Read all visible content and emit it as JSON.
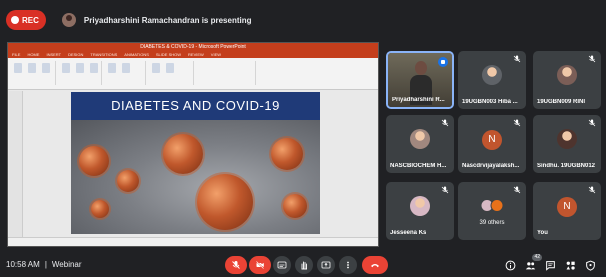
{
  "top": {
    "rec_label": "REC",
    "presenter_text": "Priyadharshini Ramachandran is presenting"
  },
  "presentation": {
    "window_title": "DIABETES & COVID-19 - Microsoft PowerPoint",
    "ribbon_tabs": [
      "FILE",
      "HOME",
      "INSERT",
      "DESIGN",
      "TRANSITIONS",
      "ANIMATIONS",
      "SLIDE SHOW",
      "REVIEW",
      "VIEW"
    ],
    "slide_title": "DIABETES AND COVID-19"
  },
  "participants": [
    {
      "name": "Priyadharshini R...",
      "type": "camera",
      "speaking": true
    },
    {
      "name": "19UGBN003 Hiba ...",
      "type": "photo",
      "muted": true,
      "color": "#5f6368"
    },
    {
      "name": "19UGBN009 RINI",
      "type": "photo",
      "muted": true,
      "color": "#7b5e57"
    },
    {
      "name": "NASCBIOCHEM H...",
      "type": "photo",
      "muted": true,
      "color": "#a1887f"
    },
    {
      "name": "Nascdrvijayalaksh...",
      "type": "letter",
      "letter": "N",
      "muted": true,
      "color": "#c1552e"
    },
    {
      "name": "Sindhu. 19UGBN012",
      "type": "photo",
      "muted": true,
      "color": "#4e342e"
    },
    {
      "name": "Jesseena Ks",
      "type": "photo",
      "muted": true,
      "color": "#d7b8c4"
    },
    {
      "name": "",
      "type": "others",
      "others_label": "39 others",
      "muted": true
    },
    {
      "name": "You",
      "type": "letter",
      "letter": "N",
      "muted": true,
      "color": "#c1552e"
    }
  ],
  "bottom": {
    "time": "10:58 AM",
    "separator": "|",
    "meeting_name": "Webinar",
    "people_count": "42"
  },
  "colors": {
    "background": "#202124",
    "tile": "#3c4043",
    "accent_red": "#ea4335",
    "accent_blue": "#8ab4f8"
  }
}
